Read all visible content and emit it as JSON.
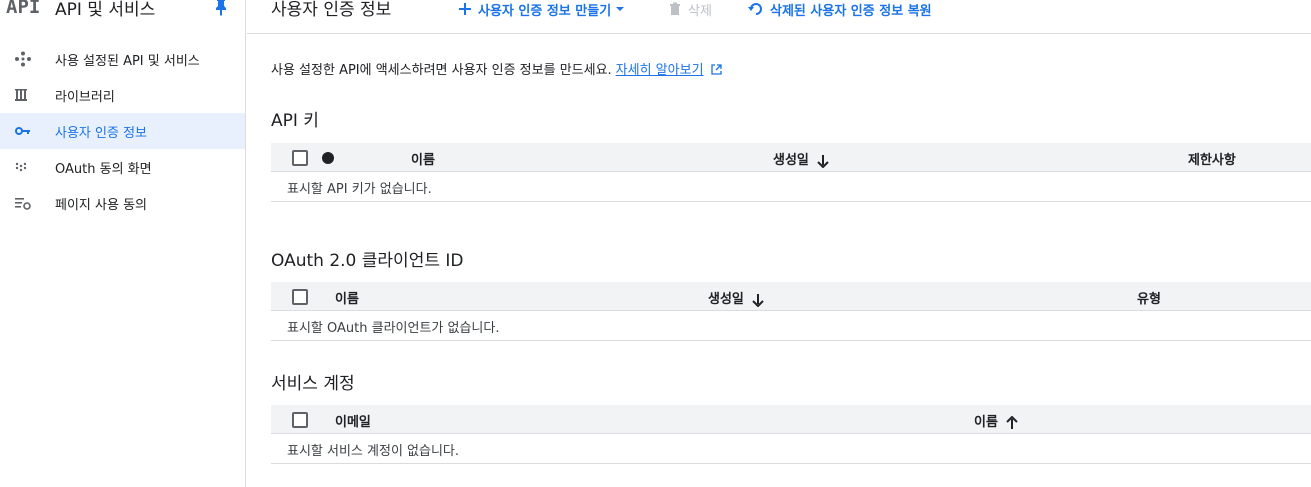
{
  "sidebar": {
    "logo": "API",
    "title": "API 및 서비스",
    "items": [
      {
        "label": "사용 설정된 API 및 서비스",
        "icon": "diamond-dots-icon",
        "active": false
      },
      {
        "label": "라이브러리",
        "icon": "library-icon",
        "active": false
      },
      {
        "label": "사용자 인증 정보",
        "icon": "key-icon",
        "active": true
      },
      {
        "label": "OAuth 동의 화면",
        "icon": "oauth-consent-icon",
        "active": false
      },
      {
        "label": "페이지 사용 동의",
        "icon": "settings-list-icon",
        "active": false
      }
    ]
  },
  "toolbar": {
    "title": "사용자 인증 정보",
    "create_label": "사용자 인증 정보 만들기",
    "delete_label": "삭제",
    "restore_label": "삭제된 사용자 인증 정보 복원"
  },
  "intro": {
    "text": "사용 설정한 API에 액세스하려면 사용자 인증 정보를 만드세요.",
    "link": "자세히 알아보기"
  },
  "api_keys": {
    "title": "API 키",
    "columns": {
      "name": "이름",
      "created": "생성일",
      "restrictions": "제한사항"
    },
    "empty": "표시할 API 키가 없습니다."
  },
  "oauth": {
    "title": "OAuth 2.0 클라이언트 ID",
    "columns": {
      "name": "이름",
      "created": "생성일",
      "type": "유형"
    },
    "empty": "표시할 OAuth 클라이언트가 없습니다."
  },
  "service_accounts": {
    "title": "서비스 계정",
    "columns": {
      "email": "이메일",
      "name": "이름"
    },
    "empty": "표시할 서비스 계정이 없습니다."
  },
  "colors": {
    "accent": "#1a73e8",
    "active_bg": "#e8f0fe",
    "header_bg": "#f1f3f4",
    "border": "#dadce0"
  }
}
